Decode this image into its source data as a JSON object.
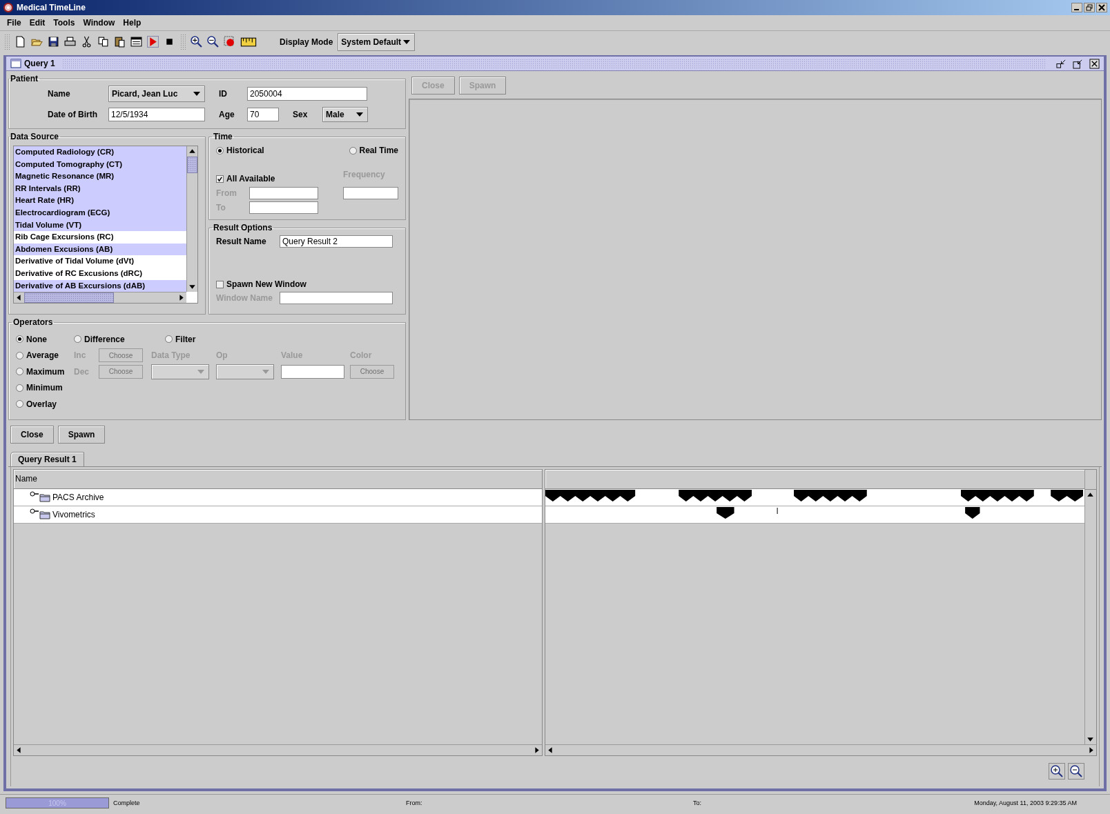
{
  "window": {
    "title": "Medical TimeLine"
  },
  "menu": [
    "File",
    "Edit",
    "Tools",
    "Window",
    "Help"
  ],
  "toolbar": {
    "display_mode_label": "Display Mode",
    "display_mode": "System Default"
  },
  "internal_frame": {
    "title": "Query 1"
  },
  "patient": {
    "title": "Patient",
    "name_label": "Name",
    "name": "Picard, Jean Luc",
    "id_label": "ID",
    "id": "2050004",
    "dob_label": "Date of Birth",
    "dob": "12/5/1934",
    "age_label": "Age",
    "age": "70",
    "sex_label": "Sex",
    "sex": "Male"
  },
  "data_source": {
    "title": "Data Source",
    "items": [
      {
        "label": "Computed Radiology (CR)",
        "selected": true
      },
      {
        "label": "Computed Tomography (CT)",
        "selected": true
      },
      {
        "label": "Magnetic Resonance (MR)",
        "selected": true
      },
      {
        "label": "RR Intervals (RR)",
        "selected": true
      },
      {
        "label": "Heart Rate (HR)",
        "selected": true
      },
      {
        "label": "Electrocardiogram (ECG)",
        "selected": true
      },
      {
        "label": "Tidal Volume (VT)",
        "selected": true
      },
      {
        "label": "Rib Cage Excursions (RC)",
        "selected": false
      },
      {
        "label": "Abdomen Excusions (AB)",
        "selected": true
      },
      {
        "label": "Derivative of Tidal Volume (dVt)",
        "selected": false
      },
      {
        "label": "Derivative of RC Excusions (dRC)",
        "selected": false
      },
      {
        "label": "Derivative of AB Excursions (dAB)",
        "selected": true
      }
    ]
  },
  "time": {
    "title": "Time",
    "modes": [
      {
        "label": "Historical",
        "selected": true
      },
      {
        "label": "Real Time",
        "selected": false
      }
    ],
    "all_available": {
      "label": "All Available",
      "checked": true
    },
    "from": {
      "label": "From",
      "disabled": true
    },
    "to": {
      "label": "To",
      "disabled": true
    },
    "frequency": {
      "label": "Frequency",
      "disabled": true
    }
  },
  "result_options": {
    "title": "Result Options",
    "result_name_label": "Result Name",
    "result_name": "Query Result 2",
    "spawn_new_window": {
      "label": "Spawn New Window",
      "checked": false
    },
    "window_name": {
      "label": "Window Name",
      "disabled": true
    }
  },
  "operators": {
    "title": "Operators",
    "options": [
      {
        "label": "None",
        "selected": true
      },
      {
        "label": "Average",
        "selected": false
      },
      {
        "label": "Maximum",
        "selected": false
      },
      {
        "label": "Minimum",
        "selected": false
      },
      {
        "label": "Overlay",
        "selected": false
      },
      {
        "label": "Difference",
        "selected": false
      },
      {
        "label": "Filter",
        "selected": false
      }
    ],
    "inc": {
      "label": "Inc",
      "button": "Choose",
      "disabled": true
    },
    "dec": {
      "label": "Dec",
      "button": "Choose",
      "disabled": true
    },
    "data_type": {
      "label": "Data Type",
      "disabled": true
    },
    "op": {
      "label": "Op",
      "disabled": true
    },
    "value": {
      "label": "Value",
      "disabled": true
    },
    "color": {
      "label": "Color",
      "button": "Choose",
      "disabled": true
    }
  },
  "preview_buttons": [
    {
      "label": "Close",
      "disabled": true
    },
    {
      "label": "Spawn",
      "disabled": true
    }
  ],
  "result_buttons": [
    {
      "label": "Close",
      "disabled": false
    },
    {
      "label": "Spawn",
      "disabled": false
    }
  ],
  "result_tabs": [
    {
      "label": "Query Result 1",
      "selected": true
    }
  ],
  "table": {
    "columns": [
      "Name"
    ],
    "rows": [
      {
        "label": "PACS Archive",
        "expanded": false
      },
      {
        "label": "Vivometrics",
        "expanded": false
      }
    ]
  },
  "status_bar": {
    "progress": {
      "level": 1,
      "text": "100%"
    },
    "status": "Complete",
    "from": "From:",
    "to": "To:",
    "datetime": "Monday, August 11, 2003 9:29:35 AM"
  }
}
